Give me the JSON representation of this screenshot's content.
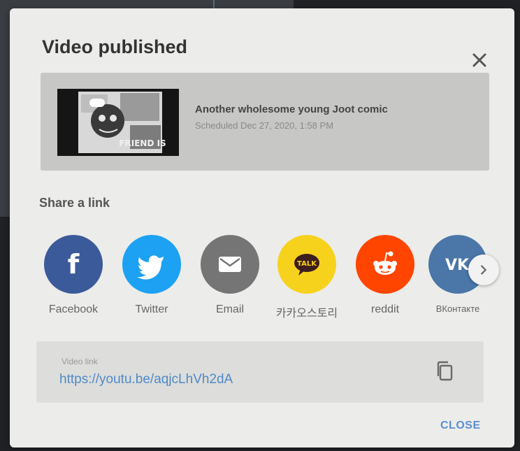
{
  "dialog": {
    "title": "Video published",
    "close_icon": "close-icon"
  },
  "video": {
    "title": "Another wholesome young Joot comic",
    "scheduled": "Scheduled Dec 27, 2020, 1:58 PM",
    "thumbnail_caption": "FRIEND IS"
  },
  "share": {
    "heading": "Share a link",
    "items": [
      {
        "label": "Facebook",
        "icon": "facebook-icon",
        "color": "#3b5a9a"
      },
      {
        "label": "Twitter",
        "icon": "twitter-icon",
        "color": "#1da1f2"
      },
      {
        "label": "Email",
        "icon": "email-icon",
        "color": "#757575"
      },
      {
        "label": "카카오스토리",
        "icon": "kakaostory-icon",
        "color": "#f7d21d",
        "badge": "TALK"
      },
      {
        "label": "reddit",
        "icon": "reddit-icon",
        "color": "#ff4500"
      },
      {
        "label": "ВКонтакте",
        "icon": "vk-icon",
        "color": "#4a76a8"
      }
    ],
    "next_icon": "chevron-right-icon"
  },
  "link": {
    "label": "Video link",
    "url": "https://youtu.be/aqjcLhVh2dA",
    "copy_icon": "copy-icon"
  },
  "footer": {
    "close_label": "CLOSE"
  },
  "colors": {
    "dialog_bg": "#ececea",
    "card_bg": "#c7c7c5",
    "link_color": "#4f8ac7",
    "accent": "#5a8ed1"
  }
}
